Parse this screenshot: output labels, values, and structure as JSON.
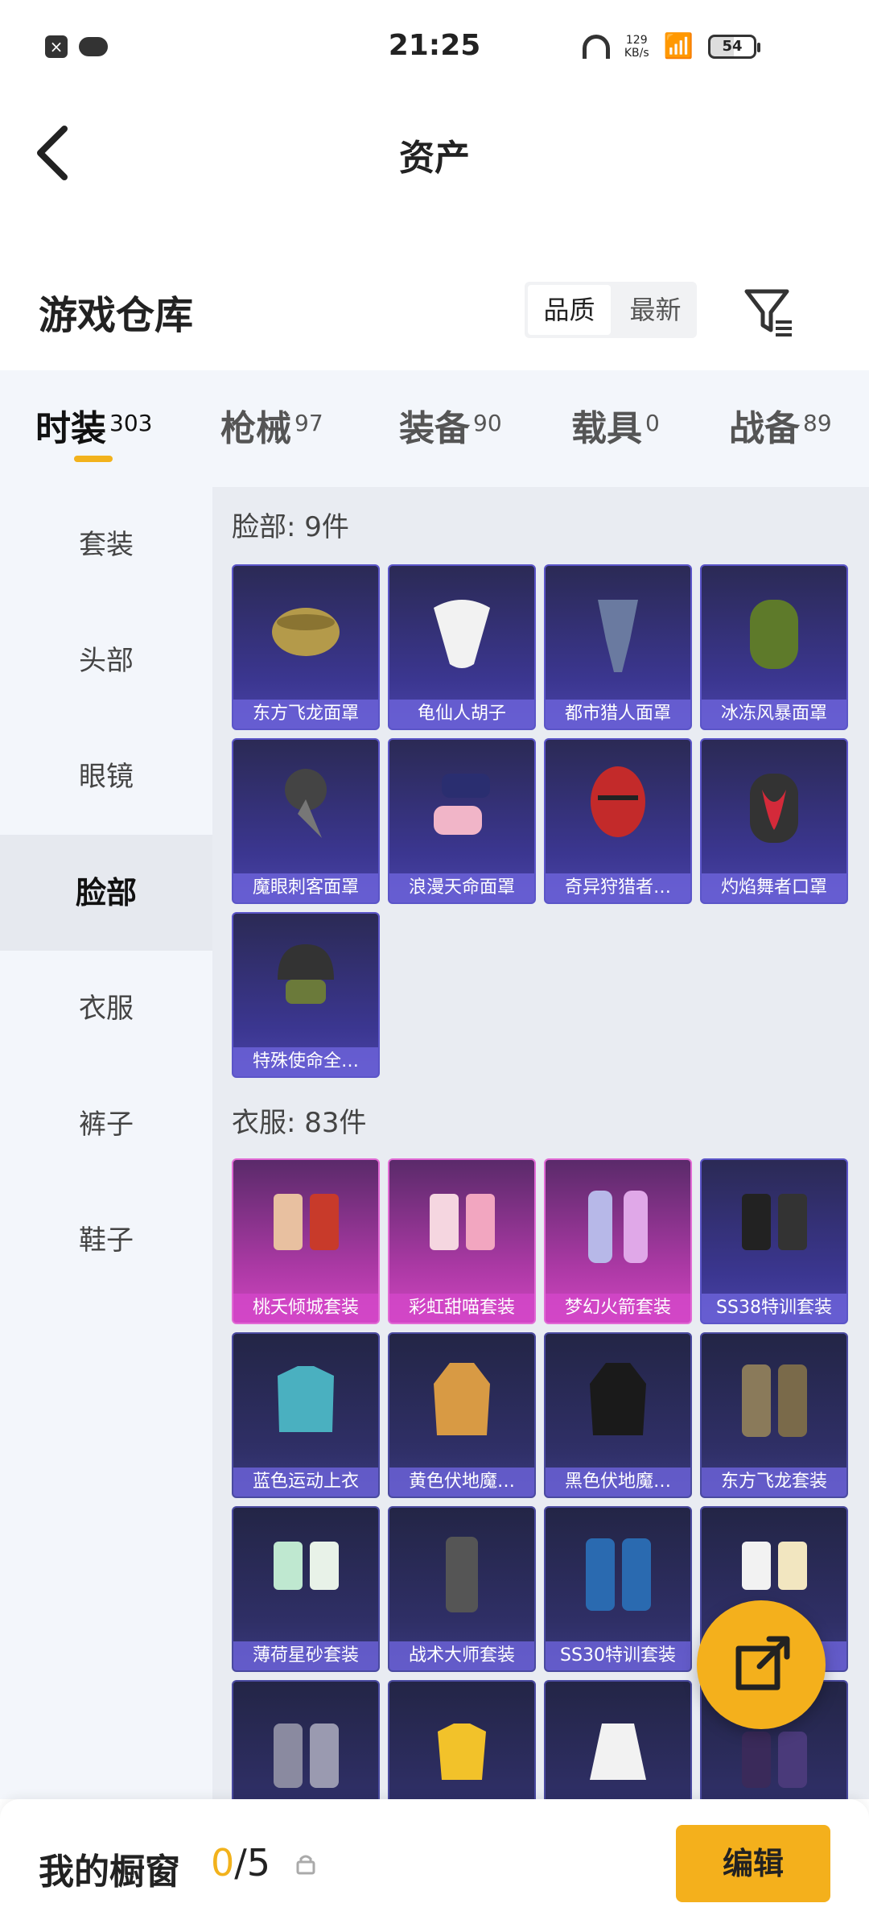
{
  "status_bar": {
    "time": "21:25",
    "speed_value": "129",
    "speed_unit": "KB/s",
    "battery": "54"
  },
  "header": {
    "title": "资产"
  },
  "warehouse": {
    "title": "游戏仓库",
    "sort_quality": "品质",
    "sort_newest": "最新"
  },
  "tabs": [
    {
      "label": "时装",
      "count": "303"
    },
    {
      "label": "枪械",
      "count": "97"
    },
    {
      "label": "装备",
      "count": "90"
    },
    {
      "label": "载具",
      "count": "0"
    },
    {
      "label": "战备",
      "count": "89"
    }
  ],
  "sidebar": {
    "items": [
      "套装",
      "头部",
      "眼镜",
      "脸部",
      "衣服",
      "裤子",
      "鞋子"
    ],
    "active": "脸部"
  },
  "sections": {
    "face": {
      "label": "脸部: 9件",
      "items": [
        "东方飞龙面罩",
        "龟仙人胡子",
        "都市猎人面罩",
        "冰冻风暴面罩",
        "魔眼刺客面罩",
        "浪漫天命面罩",
        "奇异狩猎者…",
        "灼焰舞者口罩",
        "特殊使命全…"
      ]
    },
    "clothes": {
      "label": "衣服: 83件",
      "items": [
        "桃夭倾城套装",
        "彩虹甜喵套装",
        "梦幻火箭套装",
        "SS38特训套装",
        "蓝色运动上衣",
        "黄色伏地魔…",
        "黑色伏地魔…",
        "东方飞龙套装",
        "薄荷星砂套装",
        "战术大师套装",
        "SS30特训套装",
        "",
        "",
        "",
        "",
        ""
      ]
    }
  },
  "bottom_bar": {
    "label": "我的橱窗",
    "count_current": "0",
    "count_total": "/5",
    "edit_label": "编辑"
  },
  "colors": {
    "accent": "#f4b01c",
    "card_purple": "#3b3690",
    "card_pink": "#b03aa8"
  }
}
